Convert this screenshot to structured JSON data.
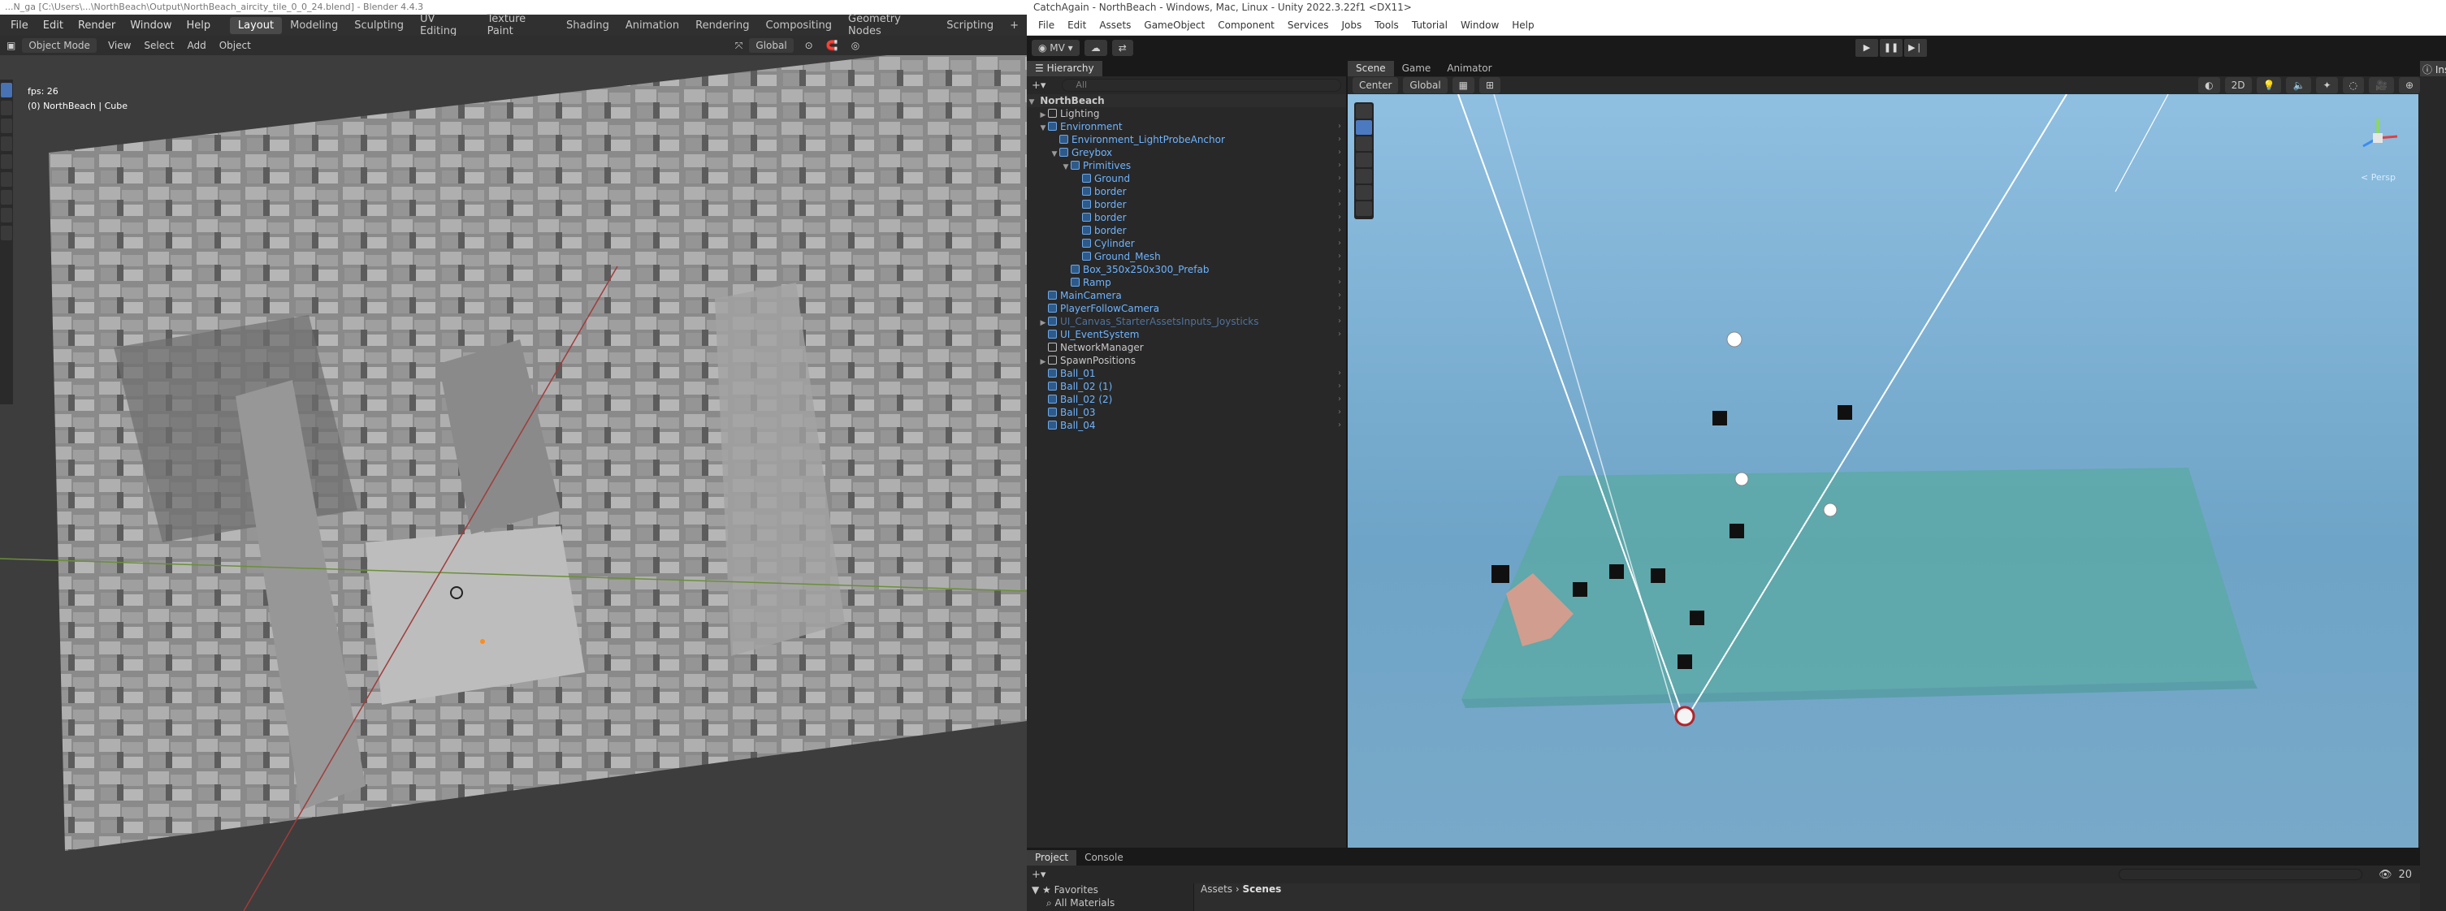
{
  "blender": {
    "title": "...N_ga [C:\\Users\\...\\NorthBeach\\Output\\NorthBeach_aircity_tile_0_0_24.blend] - Blender 4.4.3",
    "menus": [
      "File",
      "Edit",
      "Render",
      "Window",
      "Help"
    ],
    "workspaces": [
      "Layout",
      "Modeling",
      "Sculpting",
      "UV Editing",
      "Texture Paint",
      "Shading",
      "Animation",
      "Rendering",
      "Compositing",
      "Geometry Nodes",
      "Scripting"
    ],
    "active_workspace": "Layout",
    "header": {
      "mode": "Object Mode",
      "menus": [
        "View",
        "Select",
        "Add",
        "Object"
      ],
      "orientation": "Global"
    },
    "viewport": {
      "fps": "fps: 26",
      "object_info": "(0) NorthBeach | Cube"
    }
  },
  "unity": {
    "title": "CatchAgain - NorthBeach - Windows, Mac, Linux - Unity 2022.3.22f1 <DX11>",
    "menus": [
      "File",
      "Edit",
      "Assets",
      "GameObject",
      "Component",
      "Services",
      "Jobs",
      "Tools",
      "Tutorial",
      "Window",
      "Help"
    ],
    "toolbar": {
      "account": "MV"
    },
    "hierarchy": {
      "tab": "Hierarchy",
      "search_placeholder": "All",
      "scene": "NorthBeach",
      "rows": [
        {
          "depth": 1,
          "arrow": "▶",
          "label": "Lighting",
          "type": "normal"
        },
        {
          "depth": 1,
          "arrow": "▼",
          "label": "Environment",
          "type": "prefab"
        },
        {
          "depth": 2,
          "arrow": "",
          "label": "Environment_LightProbeAnchor",
          "type": "prefab"
        },
        {
          "depth": 2,
          "arrow": "▼",
          "label": "Greybox",
          "type": "prefab"
        },
        {
          "depth": 3,
          "arrow": "▼",
          "label": "Primitives",
          "type": "prefab"
        },
        {
          "depth": 4,
          "arrow": "",
          "label": "Ground",
          "type": "prefab"
        },
        {
          "depth": 4,
          "arrow": "",
          "label": "border",
          "type": "prefab"
        },
        {
          "depth": 4,
          "arrow": "",
          "label": "border",
          "type": "prefab"
        },
        {
          "depth": 4,
          "arrow": "",
          "label": "border",
          "type": "prefab"
        },
        {
          "depth": 4,
          "arrow": "",
          "label": "border",
          "type": "prefab"
        },
        {
          "depth": 4,
          "arrow": "",
          "label": "Cylinder",
          "type": "prefab"
        },
        {
          "depth": 4,
          "arrow": "",
          "label": "Ground_Mesh",
          "type": "prefab"
        },
        {
          "depth": 3,
          "arrow": "",
          "label": "Box_350x250x300_Prefab",
          "type": "prefab"
        },
        {
          "depth": 3,
          "arrow": "",
          "label": "Ramp",
          "type": "prefab"
        },
        {
          "depth": 1,
          "arrow": "",
          "label": "MainCamera",
          "type": "prefab"
        },
        {
          "depth": 1,
          "arrow": "",
          "label": "PlayerFollowCamera",
          "type": "prefab"
        },
        {
          "depth": 1,
          "arrow": "▶",
          "label": "UI_Canvas_StarterAssetsInputs_Joysticks",
          "type": "disabled"
        },
        {
          "depth": 1,
          "arrow": "",
          "label": "UI_EventSystem",
          "type": "prefab"
        },
        {
          "depth": 1,
          "arrow": "",
          "label": "NetworkManager",
          "type": "normal"
        },
        {
          "depth": 1,
          "arrow": "▶",
          "label": "SpawnPositions",
          "type": "normal"
        },
        {
          "depth": 1,
          "arrow": "",
          "label": "Ball_01",
          "type": "prefab"
        },
        {
          "depth": 1,
          "arrow": "",
          "label": "Ball_02 (1)",
          "type": "prefab"
        },
        {
          "depth": 1,
          "arrow": "",
          "label": "Ball_02 (2)",
          "type": "prefab"
        },
        {
          "depth": 1,
          "arrow": "",
          "label": "Ball_03",
          "type": "prefab"
        },
        {
          "depth": 1,
          "arrow": "",
          "label": "Ball_04",
          "type": "prefab"
        }
      ]
    },
    "scene_tabs": [
      "Scene",
      "Game",
      "Animator"
    ],
    "scene_toolbar": {
      "pivot": "Center",
      "space": "Global",
      "mode_2d": "2D"
    },
    "persp_label": "< Persp",
    "inspector_tab": "Inspector",
    "project_tabs": [
      "Project",
      "Console"
    ],
    "project": {
      "favorites": "Favorites",
      "all_materials": "All Materials",
      "breadcrumb": [
        "Assets",
        "Scenes"
      ],
      "count": "20"
    }
  }
}
